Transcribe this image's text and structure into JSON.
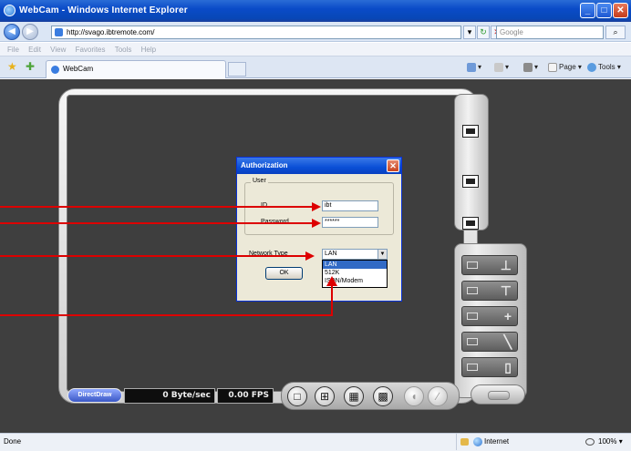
{
  "window": {
    "title": "WebCam - Windows Internet Explorer",
    "minimize": "_",
    "maximize": "□",
    "close": "✕"
  },
  "address": {
    "url": "http://svago.ibtremote.com/",
    "search_placeholder": "Google"
  },
  "menu": [
    "File",
    "Edit",
    "View",
    "Favorites",
    "Tools",
    "Help"
  ],
  "tab": {
    "title": "WebCam"
  },
  "commands": {
    "page": "Page",
    "tools": "Tools"
  },
  "player": {
    "render_mode": "DirectDraw",
    "bitrate": "0 Byte/sec",
    "fps": "0.00 FPS"
  },
  "dialog": {
    "title": "Authorization",
    "close": "✕",
    "group_label": "User",
    "id_label": "ID",
    "id_value": "ibt",
    "password_label": "Password",
    "password_value": "******",
    "network_label": "Network Type",
    "network_selected": "LAN",
    "network_options": [
      "LAN",
      "512K",
      "ISDN/Modem"
    ],
    "ok_label": "OK"
  },
  "statusbar": {
    "left": "Done",
    "zone": "Internet",
    "zoom": "100%"
  },
  "colors": {
    "title_blue": "#0a4bc8",
    "annotation_red": "#dd0000",
    "content_bg": "#3f3f3f"
  }
}
